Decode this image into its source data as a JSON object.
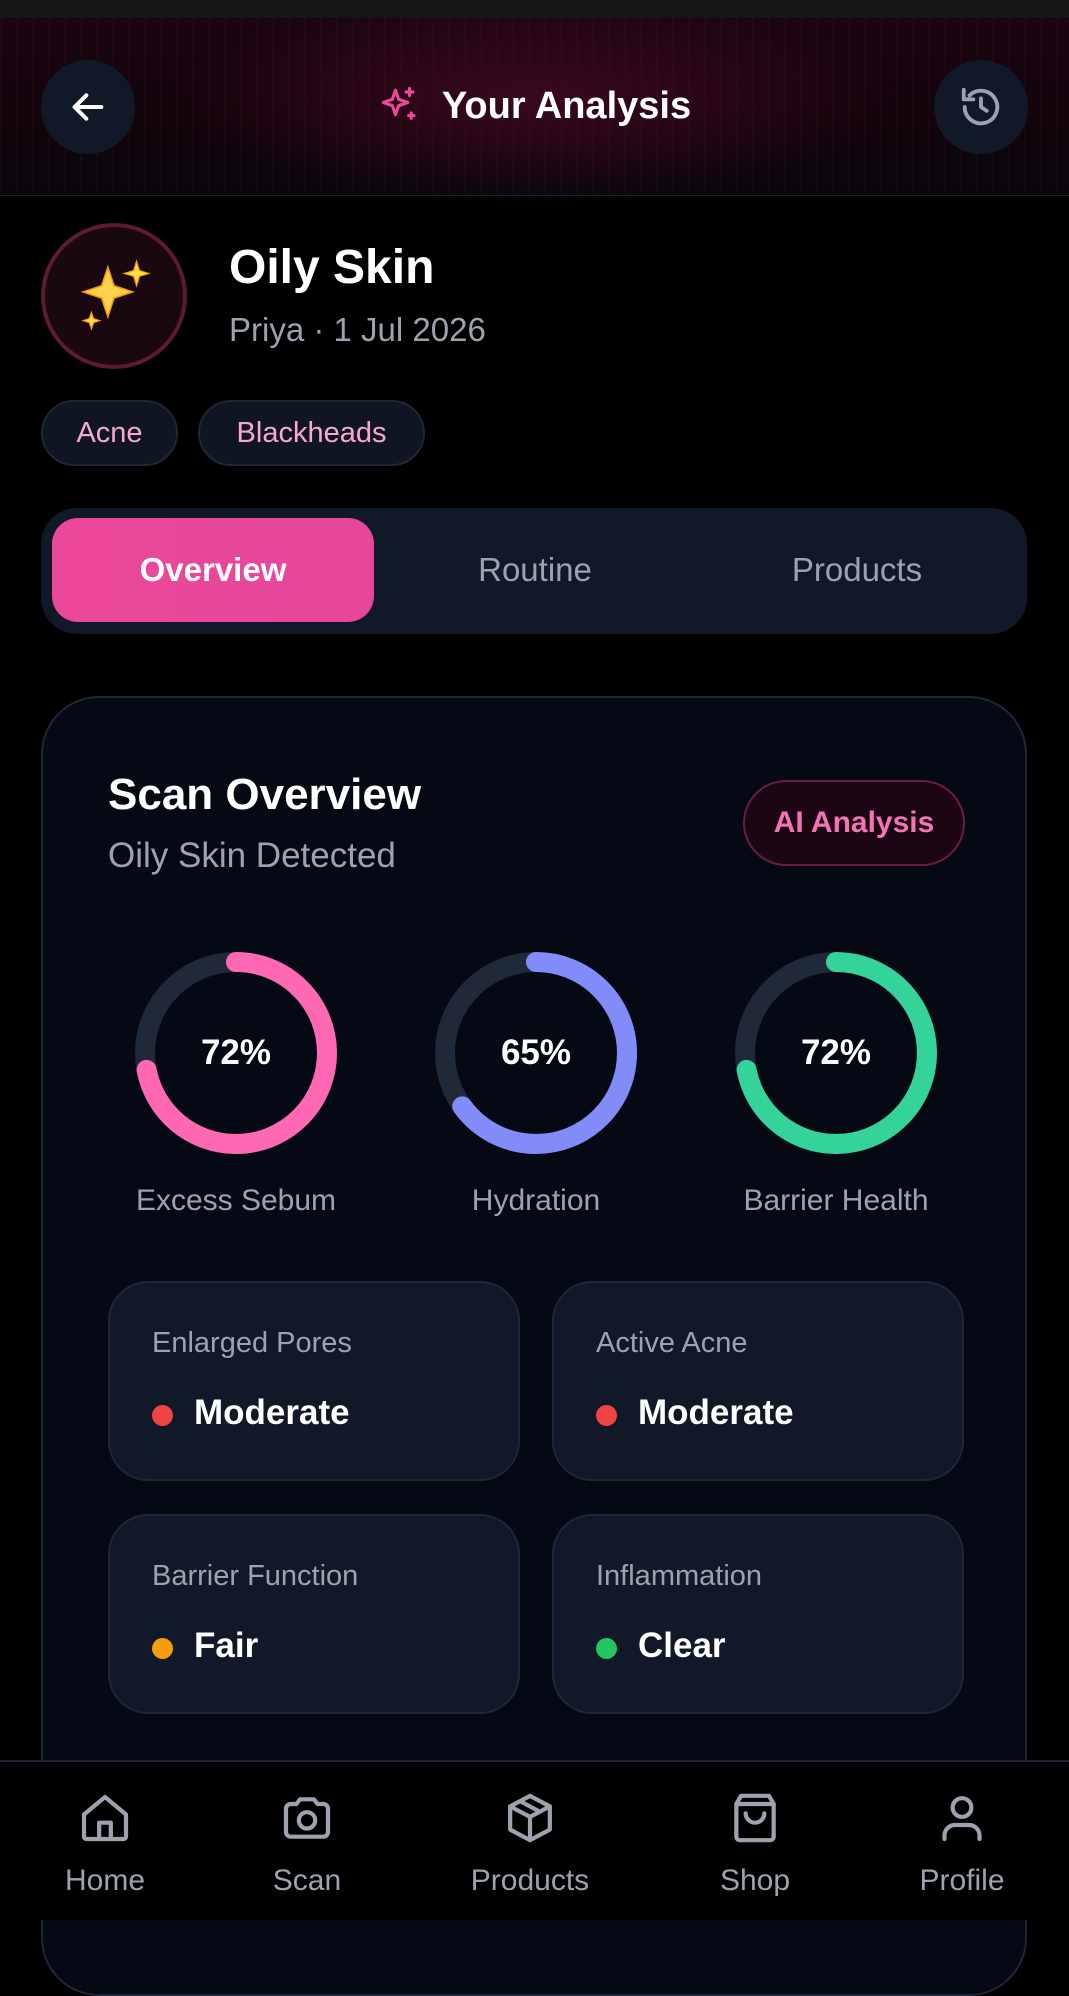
{
  "header": {
    "title": "Your Analysis",
    "back_icon": "arrow-left-icon",
    "title_icon": "sparkles-icon",
    "history_icon": "history-icon"
  },
  "profile": {
    "avatar_icon": "sparkles-emoji",
    "skin_type": "Oily Skin",
    "subtitle": "Priya · 1 Jul 2026",
    "tags": [
      "Acne",
      "Blackheads"
    ]
  },
  "tabs": [
    {
      "label": "Overview",
      "active": true
    },
    {
      "label": "Routine",
      "active": false
    },
    {
      "label": "Products",
      "active": false
    }
  ],
  "overview": {
    "title": "Scan Overview",
    "subtitle": "Oily Skin Detected",
    "badge": "AI Analysis",
    "rings": [
      {
        "label": "Excess Sebum",
        "value_text": "72%",
        "value": 72,
        "color": "#ff69b4"
      },
      {
        "label": "Hydration",
        "value_text": "65%",
        "value": 65,
        "color": "#818cf8"
      },
      {
        "label": "Barrier Health",
        "value_text": "72%",
        "value": 72,
        "color": "#34d399"
      }
    ],
    "metrics": [
      {
        "label": "Enlarged Pores",
        "value": "Moderate",
        "status_color": "#ef4444"
      },
      {
        "label": "Active Acne",
        "value": "Moderate",
        "status_color": "#ef4444"
      },
      {
        "label": "Barrier Function",
        "value": "Fair",
        "status_color": "#f59e0b"
      },
      {
        "label": "Inflammation",
        "value": "Clear",
        "status_color": "#22c55e"
      }
    ]
  },
  "bottom_nav": [
    {
      "label": "Home",
      "icon": "home-icon"
    },
    {
      "label": "Scan",
      "icon": "camera-icon"
    },
    {
      "label": "Products",
      "icon": "package-icon"
    },
    {
      "label": "Shop",
      "icon": "shopping-bag-icon"
    },
    {
      "label": "Profile",
      "icon": "user-icon"
    }
  ],
  "colors": {
    "accent": "#ec4899",
    "background": "#000000",
    "card": "#111827"
  }
}
